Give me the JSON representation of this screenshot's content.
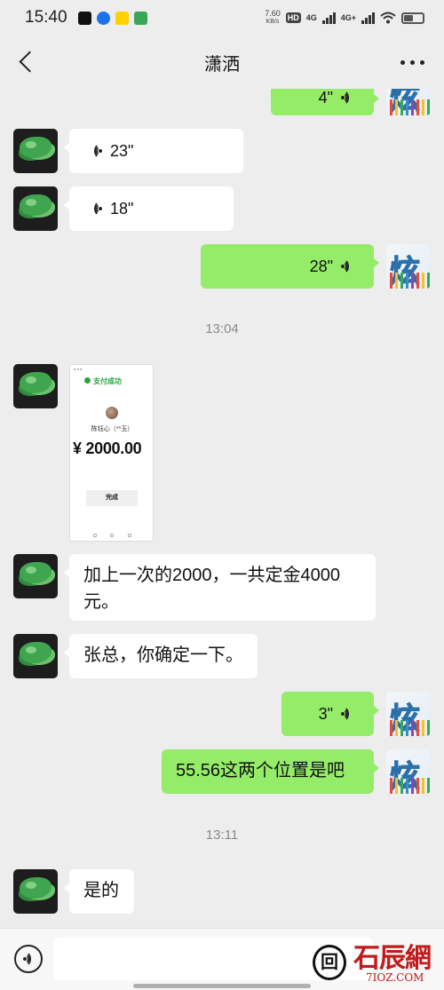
{
  "status_bar": {
    "time": "15:40",
    "net_speed_value": "7.60",
    "net_speed_unit": "KB/s",
    "hd_label": "HD",
    "network1": "4G",
    "network2": "4G+",
    "app_icons": [
      "capcut-icon",
      "chrome-icon",
      "meituan-icon",
      "fanqie-icon"
    ],
    "app_colors": [
      "#111111",
      "#1a73e8",
      "#ffd100",
      "#3aa757"
    ]
  },
  "header": {
    "title": "潇洒",
    "back_icon": "chevron-left-icon",
    "more_icon": "more-dots-icon"
  },
  "messages": [
    {
      "side": "right",
      "type": "voice",
      "duration": "4\""
    },
    {
      "side": "left",
      "type": "voice",
      "duration": "23\""
    },
    {
      "side": "left",
      "type": "voice",
      "duration": "18\""
    },
    {
      "side": "right",
      "type": "voice",
      "duration": "28\""
    },
    {
      "type": "timestamp",
      "text": "13:04"
    },
    {
      "side": "left",
      "type": "image",
      "image": {
        "title": "支付成功",
        "payee": "陈钰心（**玉）",
        "amount": "¥ 2000.00",
        "button": "完成"
      }
    },
    {
      "side": "left",
      "type": "text",
      "text": "加上一次的2000，一共定金4000元。"
    },
    {
      "side": "left",
      "type": "text",
      "text": "张总，你确定一下。"
    },
    {
      "side": "right",
      "type": "voice",
      "duration": "3\""
    },
    {
      "side": "right",
      "type": "text",
      "text": "55.56这两个位置是吧"
    },
    {
      "type": "timestamp",
      "text": "13:11"
    },
    {
      "side": "left",
      "type": "text",
      "text": "是的"
    }
  ],
  "avatars": {
    "left_desc": "jade-avatar-icon",
    "right_char": "炫"
  },
  "input_bar": {
    "voice_icon": "voice-input-icon",
    "watermark_logo": "石辰網",
    "watermark_sub": "7IOZ.COM",
    "watermark_seal": "回"
  }
}
